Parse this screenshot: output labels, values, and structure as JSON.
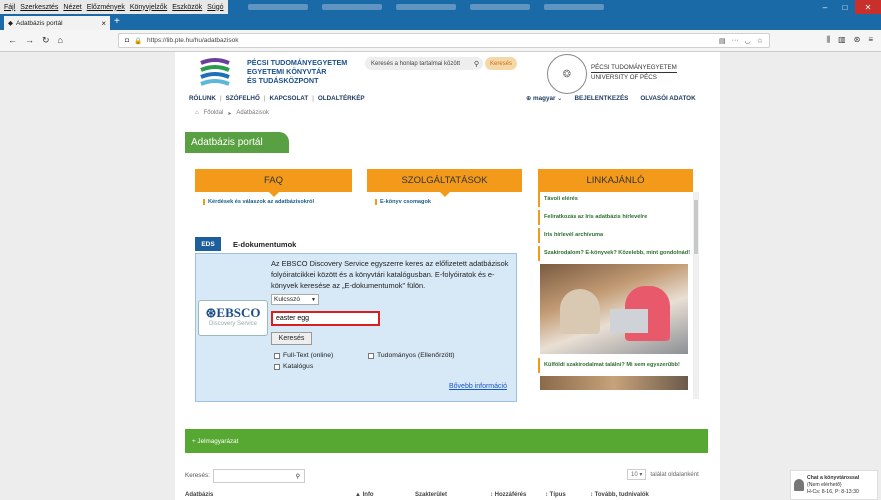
{
  "browser": {
    "menus": [
      "Fájl",
      "Szerkesztés",
      "Nézet",
      "Előzmények",
      "Könyvjelzők",
      "Eszközök",
      "Súgó"
    ],
    "tab_title": "Adatbázis portál",
    "url": "https://lib.pte.hu/hu/adatbazisok"
  },
  "header": {
    "org_lines": [
      "PÉCSI TUDOMÁNYEGYETEM",
      "EGYETEMI KÖNYVTÁR",
      "ÉS TUDÁSKÖZPONT"
    ],
    "site_search_placeholder": "Keresés a honlap tartalmai között",
    "site_search_button": "Keresés",
    "univ_lines": [
      "PÉCSI TUDOMÁNYEGYETEM",
      "UNIVERSITY OF PÉCS"
    ]
  },
  "nav": {
    "items": [
      "RÓLUNK",
      "SZÓFELHŐ",
      "KAPCSOLAT",
      "OLDALTÉRKÉP"
    ],
    "language": "magyar",
    "login": "BEJELENTKEZÉS",
    "reader_data": "OLVASÓI ADATOK"
  },
  "breadcrumb": [
    "Főoldal",
    "Adatbázisok"
  ],
  "portal_title": "Adatbázis portál",
  "boxes": {
    "faq": {
      "title": "FAQ",
      "link": "Kérdések és válaszok az adatbázisokról"
    },
    "services": {
      "title": "SZOLGÁLTATÁSOK",
      "link": "E-könyv csomagok"
    },
    "links": {
      "title": "LINKAJÁNLÓ",
      "items": [
        "Távoli elérés",
        "Feliratkozás az Iris adatbázis hírlevélre",
        "Iris hírlevél archívuma",
        "Szakirodalom? E-könyvek? Közelebb, mint gondolnád!",
        "Külföldi szakirodalmat találni? Mi sem egyszerűbb!"
      ]
    }
  },
  "eds": {
    "tab": "EDS",
    "title": "E-dokumentumok",
    "description": "Az EBSCO Discovery Service egyszerre keres az előfizetett adatbázisok folyóiratcikkei között és a könyvtári katalógusban. E-folyóiratok és e-könyvek keresése az „E-dokumentumok\" fülön.",
    "logo_brand": "EBSCO",
    "logo_sub": "Discovery Service",
    "field": "Kulcsszó",
    "query": "easter egg",
    "button": "Keresés",
    "options": [
      "Full-Text (online)",
      "Tudományos (Ellenőrzött)",
      "Katalógus"
    ],
    "more": "Bővebb információ"
  },
  "legend_bar": "+ Jelmagyarázat",
  "list": {
    "search_label": "Keresés:",
    "per_page": "10",
    "per_page_label": "találat oldalanként",
    "columns": [
      "Adatbázis",
      "▲ Info",
      "Szakterület",
      "↕ Hozzáférés",
      "↕ Típus",
      "↕ Tovább, tudnivalók"
    ]
  },
  "chat": {
    "title": "Chat a könyvtárossal",
    "status": "(Nem elérhető)",
    "hours": "H-Cs: 8-16, P: 8-13:30"
  }
}
